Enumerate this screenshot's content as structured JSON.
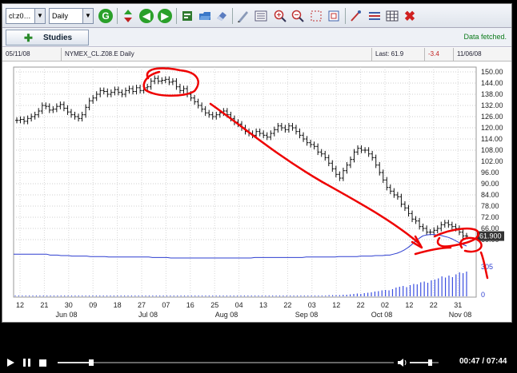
{
  "toolbar": {
    "symbol_value": "cl:z0…",
    "period_value": "Daily",
    "icons": [
      "go-icon",
      "up-down-arrows-icon",
      "back-icon",
      "forward-icon",
      "export-icon",
      "open-icon",
      "eraser-icon",
      "draw-tool-icon",
      "list-icon",
      "zoom-in-icon",
      "zoom-out-icon",
      "select-box-icon",
      "fit-icon",
      "line-tool-icon",
      "horizontal-lines-icon",
      "grid-icon",
      "close-icon"
    ]
  },
  "row2": {
    "studies_label": "Studies",
    "status": "Data fetched."
  },
  "info": {
    "start_date": "05/11/08",
    "symbol": "NYMEX_CL.Z08.E Daily",
    "last": "Last: 61.9",
    "change": "-3.4",
    "end_date": "11/06/08"
  },
  "chart_data": {
    "type": "ohlc",
    "y_ticks": [
      "150.00",
      "144.00",
      "138.00",
      "132.00",
      "126.00",
      "120.00",
      "114.00",
      "108.00",
      "102.00",
      "96.00",
      "90.00",
      "84.00",
      "78.00",
      "72.00",
      "66.00",
      "60.00"
    ],
    "y_min": 60,
    "y_max": 150,
    "last_price_label": "61.900",
    "volume_marker_label": "305",
    "volume_zero_label": "0",
    "x_day_ticks": [
      "12",
      "21",
      "30",
      "09",
      "18",
      "27",
      "07",
      "16",
      "25",
      "04",
      "13",
      "22",
      "03",
      "12",
      "22",
      "02",
      "12",
      "22",
      "31"
    ],
    "x_month_labels": [
      "Jun 08",
      "Jul 08",
      "Aug 08",
      "Sep 08",
      "Oct 08",
      "Nov 08"
    ],
    "closes": [
      124,
      124.5,
      123.5,
      125,
      126,
      127,
      129,
      132,
      131.5,
      129.5,
      130,
      131.5,
      132.5,
      130.5,
      128.5,
      127,
      126,
      125,
      127,
      131,
      134.5,
      136,
      138,
      140,
      139.5,
      138,
      139,
      140.5,
      139,
      138,
      140,
      141,
      139.5,
      141.5,
      140,
      141.5,
      142,
      145,
      146.5,
      145,
      145.5,
      146,
      144.5,
      145,
      142,
      140,
      141,
      138,
      136,
      134,
      132,
      130,
      128,
      127,
      126,
      127,
      128,
      129,
      127,
      125,
      123,
      122,
      120,
      118,
      117,
      116,
      118,
      117,
      116,
      115,
      117,
      119,
      121,
      120,
      119,
      121,
      120,
      118,
      116,
      114,
      112,
      111,
      110,
      107,
      106,
      104,
      101,
      98,
      95,
      93,
      97,
      100,
      103,
      107,
      109,
      108,
      108,
      106,
      104,
      100,
      96,
      92,
      88,
      86,
      84,
      83,
      79,
      77,
      74,
      71,
      70,
      67,
      66,
      64,
      64,
      65,
      66,
      68,
      69,
      68,
      67,
      66,
      64,
      62,
      61.9
    ],
    "volume": [
      1,
      1,
      1,
      1,
      1,
      1,
      1,
      1,
      1,
      1,
      1,
      1,
      1,
      1,
      1,
      1,
      1,
      1,
      1,
      1,
      1,
      1,
      1,
      1,
      1,
      1,
      1,
      1,
      1,
      1,
      1,
      1,
      1,
      1,
      1,
      1,
      1,
      1,
      1,
      1,
      1,
      1,
      1,
      1,
      1,
      1,
      1,
      1,
      1,
      1,
      1,
      1,
      1,
      1,
      1,
      1,
      1,
      1,
      1,
      1,
      1,
      1,
      1,
      1,
      1,
      1,
      1,
      1,
      1,
      1,
      1,
      1,
      1,
      1,
      1,
      1,
      1,
      1,
      1,
      1,
      1,
      1,
      1,
      1,
      2,
      2,
      2,
      2,
      2,
      3,
      3,
      3,
      3,
      4,
      4,
      5,
      6,
      7,
      6,
      8,
      9,
      10,
      12,
      13,
      15,
      16,
      15,
      18,
      22,
      24,
      26,
      23,
      28,
      31,
      30,
      35,
      37,
      34,
      40,
      42,
      45,
      50,
      47,
      52,
      48,
      55,
      60,
      58,
      62
    ],
    "open_interest": [
      1.0,
      1.0,
      1.0,
      1.0,
      1.0,
      1.0,
      1.0,
      1.0,
      1.0,
      1.0,
      0.98,
      0.98,
      0.98,
      0.97,
      0.97,
      0.97,
      0.96,
      0.96,
      0.96,
      0.96,
      0.96,
      0.95,
      0.95,
      0.95,
      0.95,
      0.95,
      0.94,
      0.94,
      0.94,
      0.94,
      0.94,
      0.94,
      0.94,
      0.94,
      0.94,
      0.94,
      0.94,
      0.94,
      0.93,
      0.93,
      0.93,
      0.93,
      0.93,
      0.92,
      0.92,
      0.92,
      0.92,
      0.92,
      0.92,
      0.92,
      0.92,
      0.92,
      0.92,
      0.92,
      0.92,
      0.92,
      0.92,
      0.92,
      0.92,
      0.92,
      0.92,
      0.92,
      0.92,
      0.92,
      0.92,
      0.92,
      0.93,
      0.93,
      0.93,
      0.93,
      0.93,
      0.93,
      0.93,
      0.93,
      0.93,
      0.93,
      0.93,
      0.93,
      0.93,
      0.93,
      0.94,
      0.94,
      0.94,
      0.94,
      0.94,
      0.94,
      0.94,
      0.94,
      0.94,
      0.95,
      0.95,
      0.95,
      0.95,
      0.95,
      0.95,
      0.96,
      0.96,
      0.96,
      0.96,
      0.97,
      0.97,
      0.97,
      0.98,
      0.98,
      1.0,
      1.02,
      1.05,
      1.09,
      1.14,
      1.2,
      1.27,
      1.33,
      1.38,
      1.4,
      1.41,
      1.41,
      1.4,
      1.39,
      1.37,
      1.35,
      1.32,
      1.28,
      1.24,
      1.2,
      1.17
    ]
  },
  "video": {
    "time": "00:47 / 07:44",
    "progress": 0.101,
    "volume": 0.7
  }
}
